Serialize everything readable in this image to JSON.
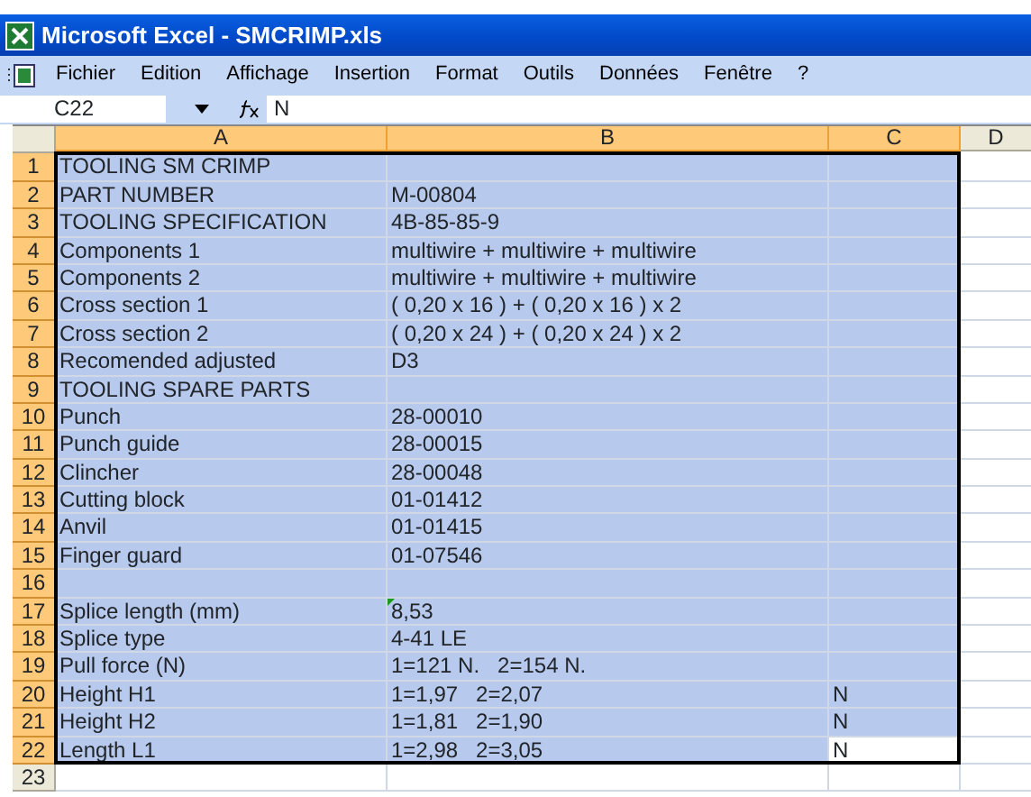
{
  "window": {
    "title": "Microsoft Excel - SMCRIMP.xls"
  },
  "menu": [
    "Fichier",
    "Edition",
    "Affichage",
    "Insertion",
    "Format",
    "Outils",
    "Données",
    "Fenêtre",
    "?"
  ],
  "formula_bar": {
    "name_box": "C22",
    "formula": "N"
  },
  "columns": [
    {
      "label": "A",
      "selected": true
    },
    {
      "label": "B",
      "selected": true
    },
    {
      "label": "C",
      "selected": true
    },
    {
      "label": "D",
      "selected": false
    }
  ],
  "rows": [
    {
      "label": "1",
      "selected": true,
      "cells": [
        {
          "text": "TOOLING SM CRIMP",
          "active": false,
          "flagged": false
        },
        {
          "active": false,
          "flagged": false
        },
        {
          "active": false,
          "flagged": false
        },
        {
          "active": false,
          "flagged": false
        }
      ]
    },
    {
      "label": "2",
      "selected": true,
      "cells": [
        {
          "text": "PART NUMBER",
          "active": false,
          "flagged": false
        },
        {
          "text": "M-00804",
          "active": false,
          "flagged": false
        },
        {
          "active": false,
          "flagged": false
        },
        {
          "active": false,
          "flagged": false
        }
      ]
    },
    {
      "label": "3",
      "selected": true,
      "cells": [
        {
          "text": "TOOLING SPECIFICATION",
          "active": false,
          "flagged": false
        },
        {
          "text": "4B-85-85-9",
          "active": false,
          "flagged": false
        },
        {
          "active": false,
          "flagged": false
        },
        {
          "active": false,
          "flagged": false
        }
      ]
    },
    {
      "label": "4",
      "selected": true,
      "cells": [
        {
          "text": "Components 1",
          "active": false,
          "flagged": false
        },
        {
          "text": "multiwire + multiwire + multiwire",
          "active": false,
          "flagged": false
        },
        {
          "active": false,
          "flagged": false
        },
        {
          "active": false,
          "flagged": false
        }
      ]
    },
    {
      "label": "5",
      "selected": true,
      "cells": [
        {
          "text": "Components 2",
          "active": false,
          "flagged": false
        },
        {
          "text": "multiwire + multiwire + multiwire",
          "active": false,
          "flagged": false
        },
        {
          "active": false,
          "flagged": false
        },
        {
          "active": false,
          "flagged": false
        }
      ]
    },
    {
      "label": "6",
      "selected": true,
      "cells": [
        {
          "text": "Cross section 1",
          "active": false,
          "flagged": false
        },
        {
          "text": "( 0,20 x 16 ) + ( 0,20 x 16 ) x 2",
          "active": false,
          "flagged": false
        },
        {
          "active": false,
          "flagged": false
        },
        {
          "active": false,
          "flagged": false
        }
      ]
    },
    {
      "label": "7",
      "selected": true,
      "cells": [
        {
          "text": "Cross section 2",
          "active": false,
          "flagged": false
        },
        {
          "text": "( 0,20 x 24 ) + ( 0,20 x 24 ) x 2",
          "active": false,
          "flagged": false
        },
        {
          "active": false,
          "flagged": false
        },
        {
          "active": false,
          "flagged": false
        }
      ]
    },
    {
      "label": "8",
      "selected": true,
      "cells": [
        {
          "text": "Recomended adjusted",
          "active": false,
          "flagged": false
        },
        {
          "text": "D3",
          "active": false,
          "flagged": false
        },
        {
          "active": false,
          "flagged": false
        },
        {
          "active": false,
          "flagged": false
        }
      ]
    },
    {
      "label": "9",
      "selected": true,
      "cells": [
        {
          "text": "TOOLING SPARE PARTS",
          "active": false,
          "flagged": false
        },
        {
          "active": false,
          "flagged": false
        },
        {
          "active": false,
          "flagged": false
        },
        {
          "active": false,
          "flagged": false
        }
      ]
    },
    {
      "label": "10",
      "selected": true,
      "cells": [
        {
          "text": "Punch",
          "active": false,
          "flagged": false
        },
        {
          "text": "28-00010",
          "active": false,
          "flagged": false
        },
        {
          "active": false,
          "flagged": false
        },
        {
          "active": false,
          "flagged": false
        }
      ]
    },
    {
      "label": "11",
      "selected": true,
      "cells": [
        {
          "text": "Punch guide",
          "active": false,
          "flagged": false
        },
        {
          "text": "28-00015",
          "active": false,
          "flagged": false
        },
        {
          "active": false,
          "flagged": false
        },
        {
          "active": false,
          "flagged": false
        }
      ]
    },
    {
      "label": "12",
      "selected": true,
      "cells": [
        {
          "text": "Clincher",
          "active": false,
          "flagged": false
        },
        {
          "text": "28-00048",
          "active": false,
          "flagged": false
        },
        {
          "active": false,
          "flagged": false
        },
        {
          "active": false,
          "flagged": false
        }
      ]
    },
    {
      "label": "13",
      "selected": true,
      "cells": [
        {
          "text": "Cutting block",
          "active": false,
          "flagged": false
        },
        {
          "text": "01-01412",
          "active": false,
          "flagged": false
        },
        {
          "active": false,
          "flagged": false
        },
        {
          "active": false,
          "flagged": false
        }
      ]
    },
    {
      "label": "14",
      "selected": true,
      "cells": [
        {
          "text": "Anvil",
          "active": false,
          "flagged": false
        },
        {
          "text": "01-01415",
          "active": false,
          "flagged": false
        },
        {
          "active": false,
          "flagged": false
        },
        {
          "active": false,
          "flagged": false
        }
      ]
    },
    {
      "label": "15",
      "selected": true,
      "cells": [
        {
          "text": "Finger guard",
          "active": false,
          "flagged": false
        },
        {
          "text": "01-07546",
          "active": false,
          "flagged": false
        },
        {
          "active": false,
          "flagged": false
        },
        {
          "active": false,
          "flagged": false
        }
      ]
    },
    {
      "label": "16",
      "selected": true,
      "cells": [
        {
          "active": false,
          "flagged": false
        },
        {
          "active": false,
          "flagged": false
        },
        {
          "active": false,
          "flagged": false
        },
        {
          "active": false,
          "flagged": false
        }
      ]
    },
    {
      "label": "17",
      "selected": true,
      "cells": [
        {
          "text": "Splice length (mm)",
          "active": false,
          "flagged": false
        },
        {
          "text": "8,53",
          "active": false,
          "flagged": true
        },
        {
          "active": false,
          "flagged": false
        },
        {
          "active": false,
          "flagged": false
        }
      ]
    },
    {
      "label": "18",
      "selected": true,
      "cells": [
        {
          "text": "Splice type",
          "active": false,
          "flagged": false
        },
        {
          "text": "4-41 LE",
          "active": false,
          "flagged": false
        },
        {
          "active": false,
          "flagged": false
        },
        {
          "active": false,
          "flagged": false
        }
      ]
    },
    {
      "label": "19",
      "selected": true,
      "cells": [
        {
          "text": "Pull force (N)",
          "active": false,
          "flagged": false
        },
        {
          "text": "1=121 N.   2=154 N.",
          "active": false,
          "flagged": false
        },
        {
          "active": false,
          "flagged": false
        },
        {
          "active": false,
          "flagged": false
        }
      ]
    },
    {
      "label": "20",
      "selected": true,
      "cells": [
        {
          "text": "Height H1",
          "active": false,
          "flagged": false
        },
        {
          "text": "1=1,97   2=2,07",
          "active": false,
          "flagged": false
        },
        {
          "text": "N",
          "active": false,
          "flagged": false
        },
        {
          "active": false,
          "flagged": false
        }
      ]
    },
    {
      "label": "21",
      "selected": true,
      "cells": [
        {
          "text": "Height H2",
          "active": false,
          "flagged": false
        },
        {
          "text": "1=1,81   2=1,90",
          "active": false,
          "flagged": false
        },
        {
          "text": "N",
          "active": false,
          "flagged": false
        },
        {
          "active": false,
          "flagged": false
        }
      ]
    },
    {
      "label": "22",
      "selected": true,
      "cells": [
        {
          "text": "Length L1",
          "active": false,
          "flagged": false
        },
        {
          "text": "1=2,98   2=3,05",
          "active": false,
          "flagged": false
        },
        {
          "text": "N",
          "active": true,
          "flagged": false
        },
        {
          "active": false,
          "flagged": false
        }
      ]
    },
    {
      "label": "23",
      "selected": false,
      "cells": [
        {
          "active": false,
          "flagged": false
        },
        {
          "active": false,
          "flagged": false
        },
        {
          "active": false,
          "flagged": false
        },
        {
          "active": false,
          "flagged": false
        }
      ]
    }
  ]
}
